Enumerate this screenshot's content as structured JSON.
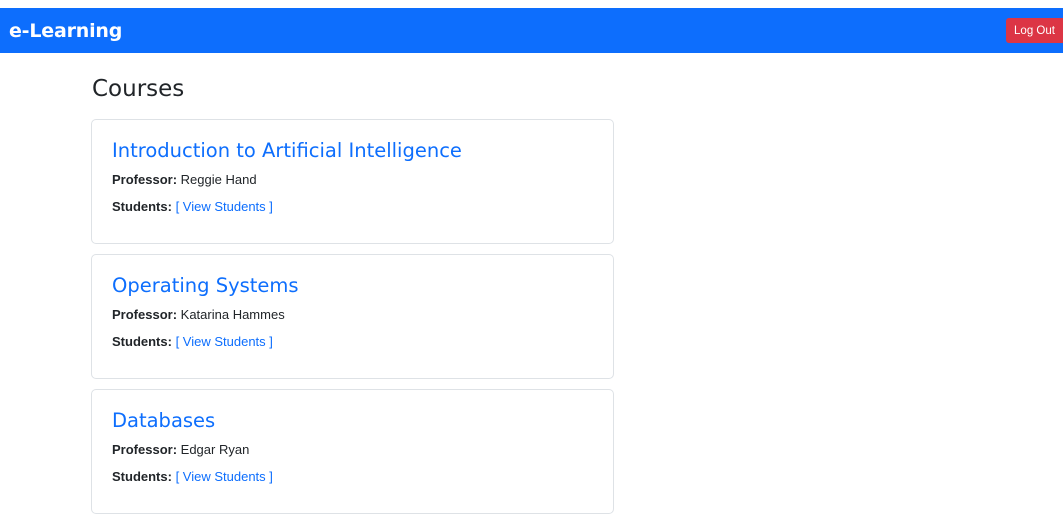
{
  "navbar": {
    "brand": "e-Learning",
    "logout_label": "Log Out"
  },
  "page": {
    "title": "Courses"
  },
  "labels": {
    "professor": "Professor:",
    "students": "Students:",
    "view_students": "[ View Students ]"
  },
  "courses": [
    {
      "title": "Introduction to Artificial Intelligence",
      "professor": "Reggie Hand"
    },
    {
      "title": "Operating Systems",
      "professor": "Katarina Hammes"
    },
    {
      "title": "Databases",
      "professor": "Edgar Ryan"
    }
  ],
  "colors": {
    "navbar": "#0d6efd",
    "logout": "#dc3545",
    "link": "#0d6efd",
    "card_border": "#dee2e6"
  }
}
